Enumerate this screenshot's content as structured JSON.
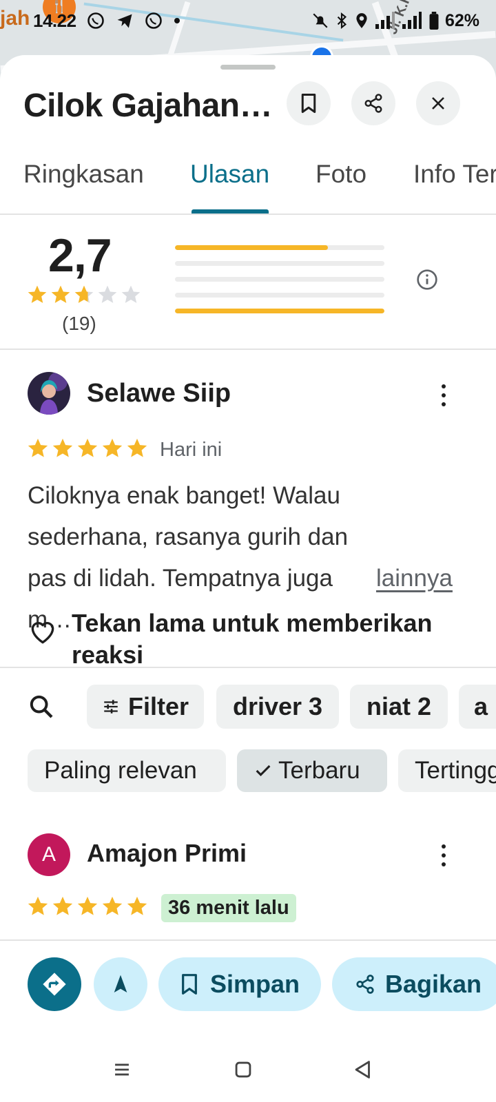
{
  "status_bar": {
    "time": "14.22",
    "battery_percent": "62%",
    "network": "4G"
  },
  "map": {
    "place_label": "jah",
    "place_label_top": "g",
    "street_label": "Jl. K.H."
  },
  "place": {
    "title": "Cilok Gajahan Pakdhe"
  },
  "header_actions": {
    "save": "bookmark-icon",
    "share": "share-icon",
    "close": "close-icon"
  },
  "tabs": [
    {
      "label": "Ringkasan",
      "active": false
    },
    {
      "label": "Ulasan",
      "active": true
    },
    {
      "label": "Foto",
      "active": false
    },
    {
      "label": "Info Terkait",
      "active": false
    }
  ],
  "rating_summary": {
    "average": "2,7",
    "average_value": 2.7,
    "count": "(19)",
    "distribution": [
      {
        "stars": 5,
        "fraction": 0.73
      },
      {
        "stars": 4,
        "fraction": 0.0
      },
      {
        "stars": 3,
        "fraction": 0.0
      },
      {
        "stars": 2,
        "fraction": 0.0
      },
      {
        "stars": 1,
        "fraction": 1.0
      }
    ],
    "colors": {
      "star": "#f6b627",
      "empty_star": "#dadce0"
    }
  },
  "reviews": [
    {
      "name": "Selawe Siip",
      "stars": 5,
      "date": "Hari ini",
      "text": "Ciloknya enak banget! Walau sederhana, rasanya gurih dan pas di lidah. Tempatnya juga m…",
      "more": "lainnya",
      "reaction_hint": "Tekan lama untuk memberikan reaksi"
    },
    {
      "name": "Amajon Primi",
      "initial": "A",
      "stars": 5,
      "date": "36 menit lalu"
    }
  ],
  "filters": {
    "search_icon": "search-icon",
    "chips": [
      "Filter",
      "driver 3",
      "niat 2",
      "a"
    ]
  },
  "sort_options": [
    {
      "label": "Paling relevan",
      "selected": false
    },
    {
      "label": "Terbaru",
      "selected": true
    },
    {
      "label": "Tertinggi",
      "selected": false
    }
  ],
  "bottom_actions": {
    "directions_icon": "directions-icon",
    "start_icon": "navigation-arrow-icon",
    "save_label": "Simpan",
    "share_label": "Bagikan"
  },
  "colors": {
    "accent": "#0b6f8a",
    "tonal": "#cdeffb",
    "new_badge": "#cdf0d2",
    "avatar_a": "#c2185b"
  }
}
